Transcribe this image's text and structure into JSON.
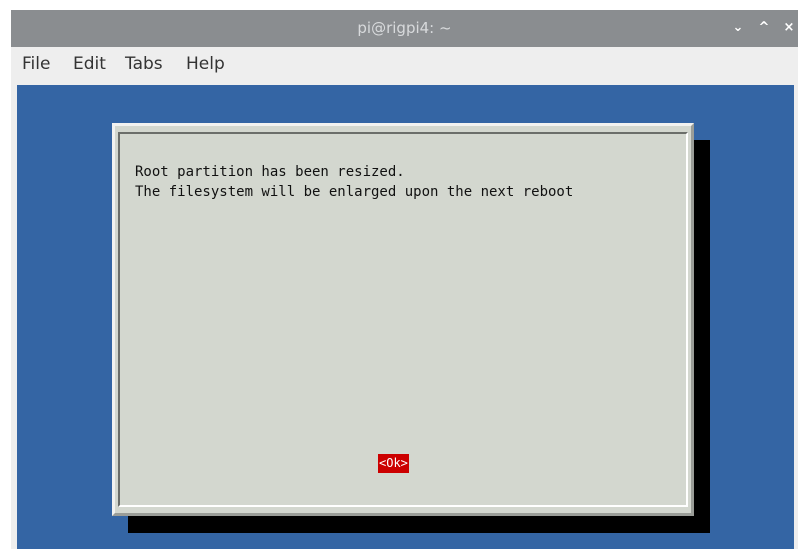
{
  "window": {
    "title": "pi@rigpi4: ~",
    "controls": {
      "minimize": "⌄",
      "maximize": "^",
      "close": "×"
    }
  },
  "menubar": {
    "items": [
      {
        "label": "File"
      },
      {
        "label": "Edit"
      },
      {
        "label": "Tabs"
      },
      {
        "label": "Help"
      }
    ]
  },
  "dialog": {
    "lines": [
      "Root partition has been resized.",
      "The filesystem will be enlarged upon the next reboot"
    ],
    "ok_label": "<Ok>"
  },
  "colors": {
    "terminal_background": "#3465a4",
    "dialog_background": "#d3d7cf",
    "button_highlight": "#cc0000",
    "titlebar": "#8a8d90"
  }
}
